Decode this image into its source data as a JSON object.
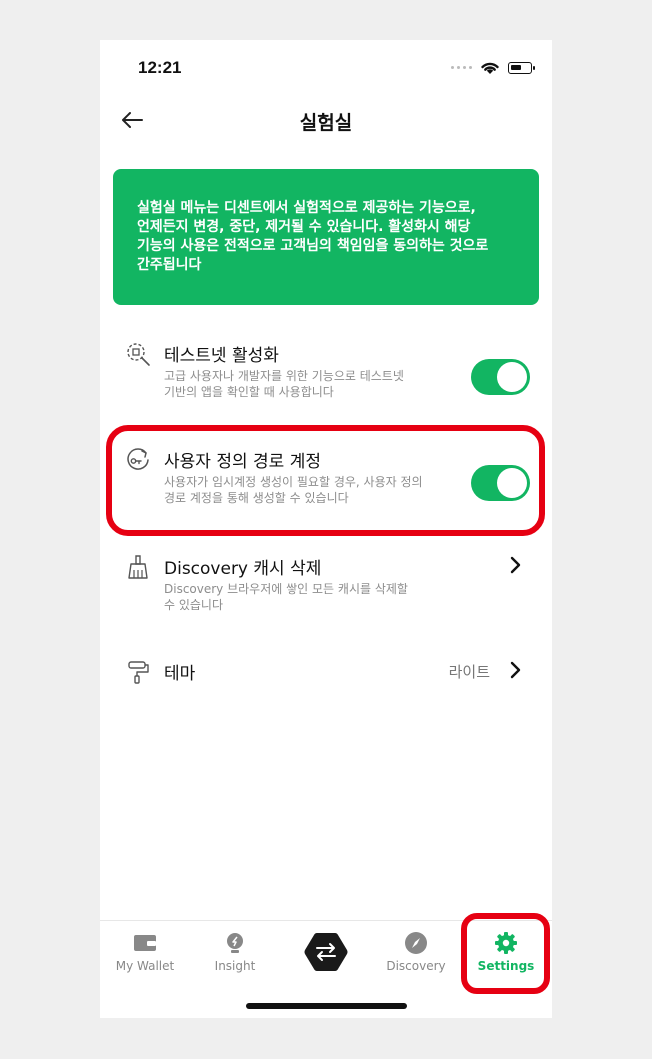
{
  "status_bar": {
    "time": "12:21"
  },
  "header": {
    "title": "실험실"
  },
  "notice": {
    "lines": [
      "실험실 메뉴는 디센트에서 실험적으로 제공하는 기능으로,",
      "언제든지 변경, 중단, 제거될 수 있습니다. 활성화시 해당",
      "기능의 사용은 전적으로 고객님의 책임임을 동의하는 것으로",
      "간주됩니다"
    ]
  },
  "settings": {
    "testnet": {
      "title": "테스트넷 활성화",
      "desc_lines": [
        "고급 사용자나 개발자를 위한 기능으로 테스트넷",
        "기반의 앱을 확인할 때 사용합니다"
      ],
      "enabled": true
    },
    "custom_path": {
      "title": "사용자 정의 경로 계정",
      "desc_lines": [
        "사용자가 임시계정 생성이 필요할 경우, 사용자 정의",
        "경로 계정을 통해 생성할 수 있습니다"
      ],
      "enabled": true
    },
    "discovery_cache": {
      "title": "Discovery 캐시 삭제",
      "desc_lines": [
        "Discovery 브라우저에 쌓인 모든 캐시를 삭제할",
        "수 있습니다"
      ]
    },
    "theme": {
      "title": "테마",
      "value": "라이트"
    }
  },
  "tab_bar": {
    "tabs": [
      {
        "label": "My Wallet",
        "icon": "wallet-icon"
      },
      {
        "label": "Insight",
        "icon": "lightbulb-icon"
      },
      {
        "label": "",
        "icon": "swap-icon"
      },
      {
        "label": "Discovery",
        "icon": "compass-icon"
      },
      {
        "label": "Settings",
        "icon": "gear-icon"
      }
    ],
    "active": "Settings"
  },
  "colors": {
    "accent": "#12b562",
    "highlight": "#e60012",
    "muted_text": "#8d8d8d"
  }
}
